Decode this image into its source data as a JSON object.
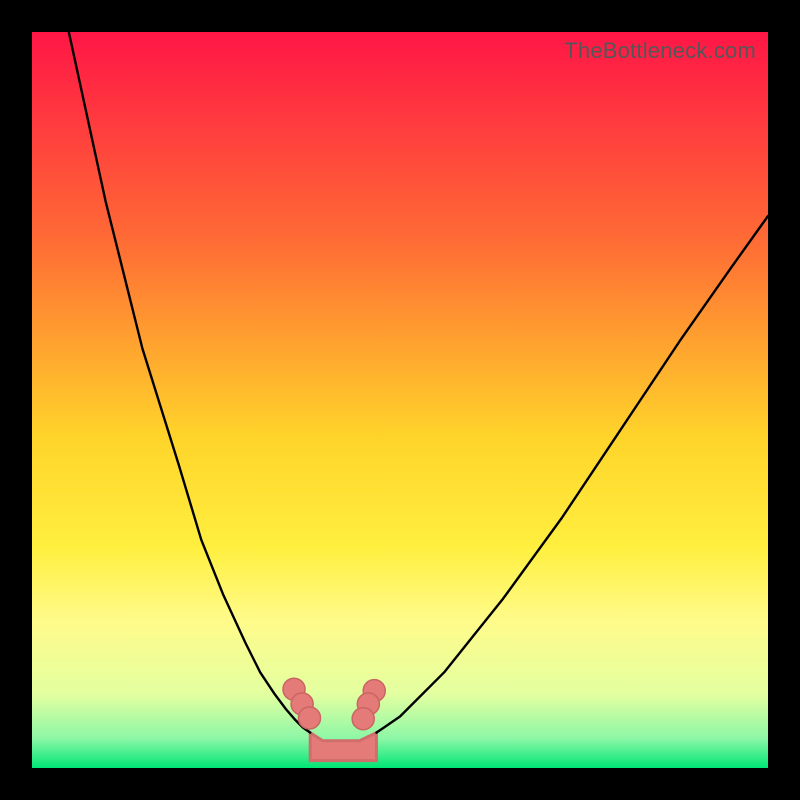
{
  "watermark": "TheBottleneck.com",
  "chart_data": {
    "type": "line",
    "title": "",
    "xlabel": "",
    "ylabel": "",
    "xlim_fraction": [
      0,
      1
    ],
    "ylim_fraction": [
      0,
      1
    ],
    "gradient_stops": [
      {
        "offset": 0.0,
        "color": "#ff1646"
      },
      {
        "offset": 0.28,
        "color": "#ff6a35"
      },
      {
        "offset": 0.55,
        "color": "#ffd42a"
      },
      {
        "offset": 0.7,
        "color": "#ffef3f"
      },
      {
        "offset": 0.8,
        "color": "#fffb8a"
      },
      {
        "offset": 0.9,
        "color": "#e3ffa0"
      },
      {
        "offset": 0.96,
        "color": "#8cf7a6"
      },
      {
        "offset": 1.0,
        "color": "#00e676"
      }
    ],
    "series": [
      {
        "name": "left-curve",
        "x": [
          0.05,
          0.1,
          0.15,
          0.2,
          0.23,
          0.26,
          0.29,
          0.31,
          0.33,
          0.345,
          0.358,
          0.368,
          0.378
        ],
        "y": [
          0.0,
          0.23,
          0.43,
          0.59,
          0.69,
          0.765,
          0.83,
          0.87,
          0.9,
          0.92,
          0.935,
          0.945,
          0.952
        ]
      },
      {
        "name": "right-curve",
        "x": [
          0.468,
          0.5,
          0.56,
          0.64,
          0.72,
          0.8,
          0.88,
          0.95,
          1.0
        ],
        "y": [
          0.952,
          0.93,
          0.87,
          0.77,
          0.66,
          0.54,
          0.42,
          0.32,
          0.25
        ]
      }
    ],
    "valley_dots": {
      "xy": [
        [
          0.356,
          0.893
        ],
        [
          0.367,
          0.913
        ],
        [
          0.377,
          0.932
        ],
        [
          0.465,
          0.895
        ],
        [
          0.457,
          0.913
        ],
        [
          0.45,
          0.933
        ]
      ],
      "radius_fraction": 0.015,
      "fill": "#e47b79",
      "stroke": "#c96563"
    },
    "valley_band": {
      "polygon_xy": [
        [
          0.378,
          0.952
        ],
        [
          0.395,
          0.963
        ],
        [
          0.42,
          0.963
        ],
        [
          0.445,
          0.963
        ],
        [
          0.468,
          0.952
        ],
        [
          0.468,
          0.99
        ],
        [
          0.378,
          0.99
        ]
      ],
      "fill": "#e47b79",
      "stroke": "#d06e6c"
    }
  }
}
